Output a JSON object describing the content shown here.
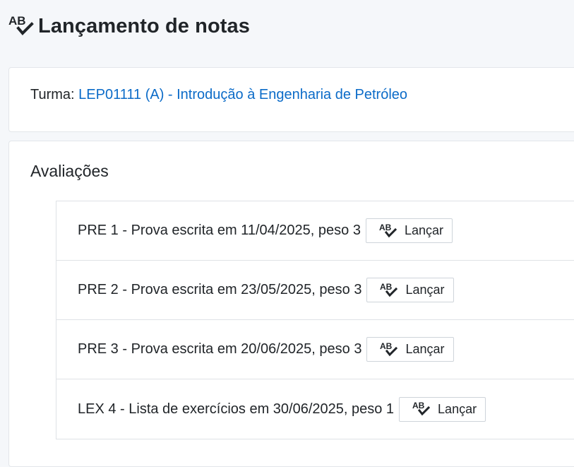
{
  "header": {
    "icon": "spellcheck-icon",
    "title": "Lançamento de notas"
  },
  "turma": {
    "label": "Turma:",
    "link_text": "LEP01111 (A) - Introdução à Engenharia de Petróleo"
  },
  "avaliacoes": {
    "title": "Avaliações",
    "items": [
      {
        "text": "PRE 1 - Prova escrita em 11/04/2025, peso 3",
        "button_label": "Lançar"
      },
      {
        "text": "PRE 2 - Prova escrita em 23/05/2025, peso 3",
        "button_label": "Lançar"
      },
      {
        "text": "PRE 3 - Prova escrita em 20/06/2025, peso 3",
        "button_label": "Lançar"
      },
      {
        "text": "LEX 4 - Lista de exercícios em 30/06/2025, peso 1",
        "button_label": "Lançar"
      }
    ]
  },
  "colors": {
    "link": "#0b6bc8",
    "text": "#212529",
    "background": "#f5f7fa"
  }
}
